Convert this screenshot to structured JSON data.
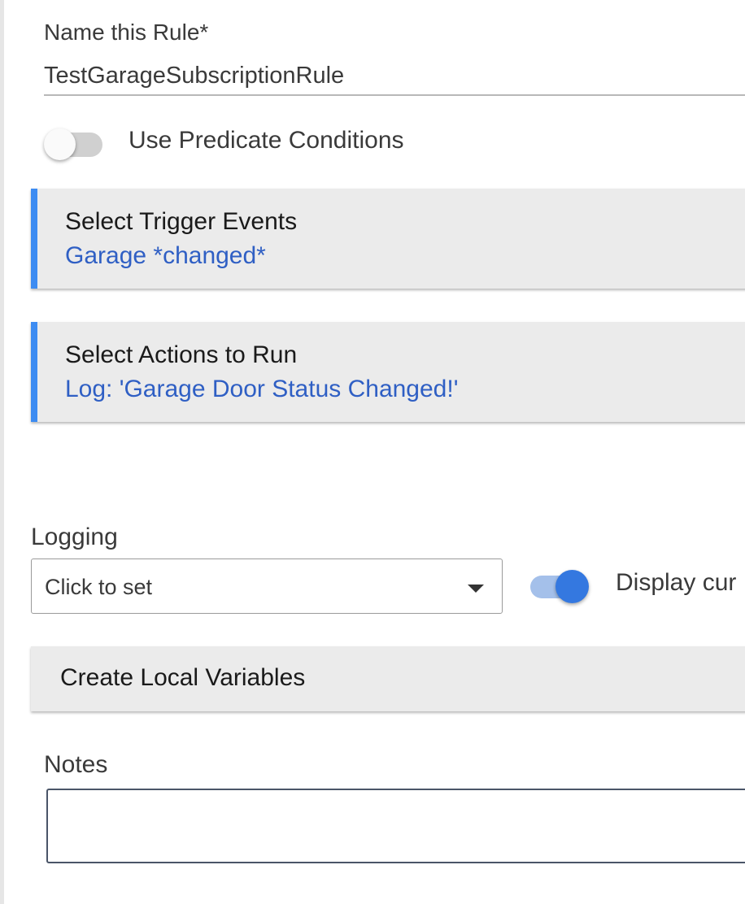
{
  "rule_name": {
    "label": "Name this Rule*",
    "value": "TestGarageSubscriptionRule"
  },
  "predicate": {
    "label": "Use Predicate Conditions",
    "enabled": false
  },
  "trigger_section": {
    "title": "Select Trigger Events",
    "value": "Garage *changed*"
  },
  "actions_section": {
    "title": "Select Actions to Run",
    "value": "Log: 'Garage Door Status Changed!'"
  },
  "logging": {
    "label": "Logging",
    "selected": "Click to set"
  },
  "display_toggle": {
    "label": "Display cur",
    "enabled": true
  },
  "local_variables": {
    "title": "Create Local Variables"
  },
  "notes": {
    "label": "Notes",
    "value": ""
  },
  "colors": {
    "accent": "#3d8cf2",
    "link": "#2f5fc4",
    "toggle_on": "#3478e0",
    "card_bg": "#ebebeb"
  },
  "icons": {
    "dropdown_caret": "caret-down-icon"
  }
}
